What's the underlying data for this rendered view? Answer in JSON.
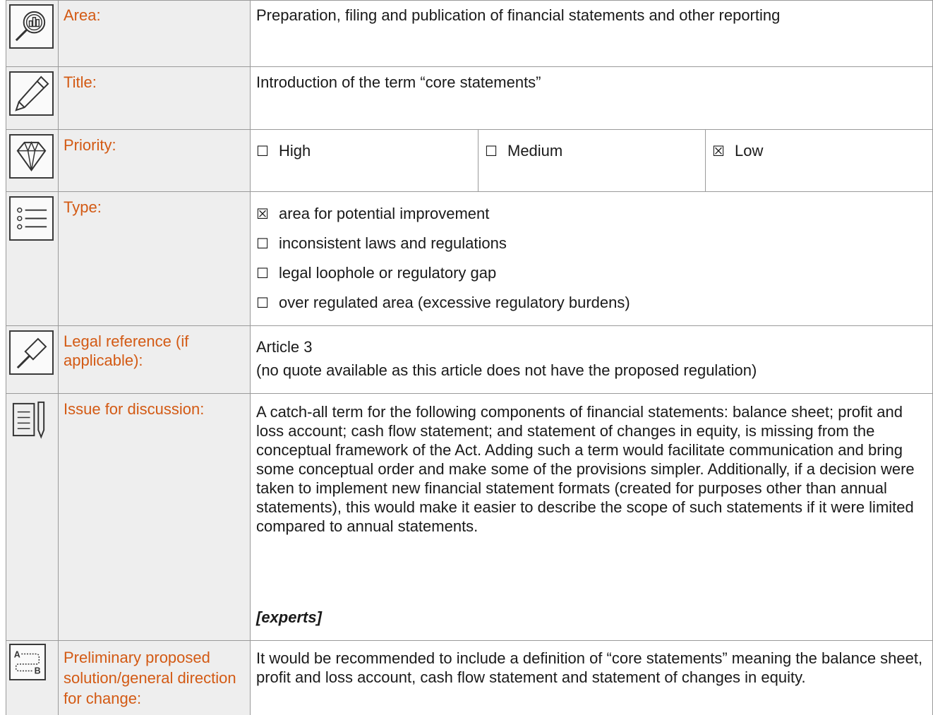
{
  "rows": {
    "area": {
      "label": "Area:",
      "value": "Preparation, filing and publication of financial statements and other reporting"
    },
    "title": {
      "label": "Title:",
      "value": "Introduction of the term “core statements”"
    },
    "priority": {
      "label": "Priority:",
      "options": [
        {
          "box": "☐",
          "text": "High"
        },
        {
          "box": "☐",
          "text": "Medium"
        },
        {
          "box": "☒",
          "text": "Low"
        }
      ]
    },
    "type": {
      "label": "Type:",
      "options": [
        {
          "box": "☒",
          "text": "area for potential improvement"
        },
        {
          "box": "☐",
          "text": "inconsistent laws and regulations"
        },
        {
          "box": "☐",
          "text": "legal loophole or regulatory gap"
        },
        {
          "box": "☐",
          "text": "over regulated area (excessive regulatory burdens)"
        }
      ]
    },
    "legal": {
      "label": "Legal reference (if applicable):",
      "line1": "Article 3",
      "line2": "(no quote available as this article does not have the proposed regulation)"
    },
    "issue": {
      "label": "Issue for discussion:",
      "text": "A catch-all term for the following components of financial statements: balance sheet; profit and loss account; cash flow statement; and statement of changes in equity, is missing from the conceptual framework of the Act. Adding such a term would facilitate communication and bring some conceptual order and make some of the provisions simpler. Additionally, if a decision were taken to implement new financial statement formats (created for purposes other than annual statements), this would make it easier to describe the scope of such statements if it were limited compared to annual statements.",
      "source": "[experts]"
    },
    "solution": {
      "label": "Preliminary proposed solution/general direction for change:",
      "text": "It would be recommended to include a definition of “core statements” meaning the balance sheet, profit and loss account, cash flow statement and statement of changes in equity."
    }
  },
  "icons": {
    "area": "magnifier-chart-icon",
    "title": "pencil-icon",
    "priority": "diamond-icon",
    "type": "list-icon",
    "legal": "gavel-icon",
    "issue": "document-pen-icon",
    "solution": "a-to-b-path-icon"
  },
  "colors": {
    "label": "#d35a14",
    "label_bg": "#eeeeee",
    "border": "#9a9a9a"
  }
}
